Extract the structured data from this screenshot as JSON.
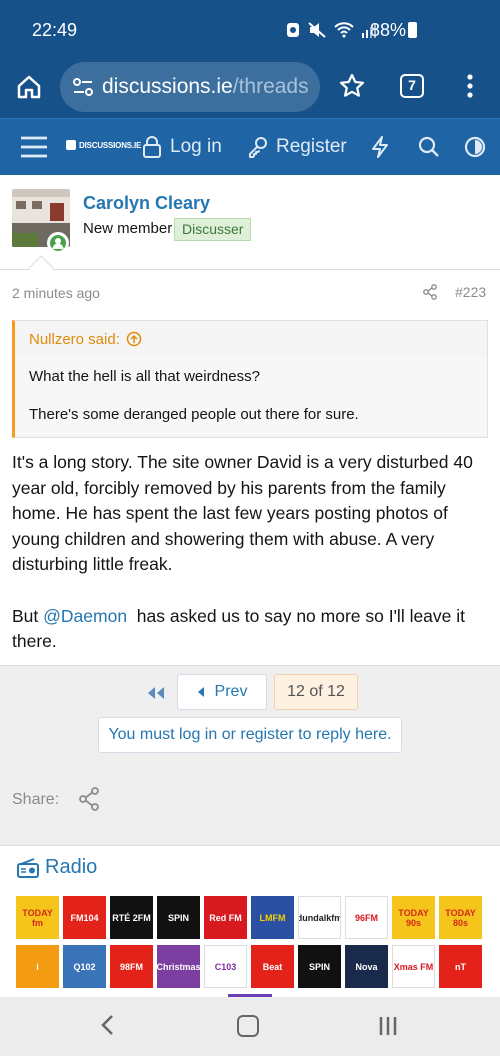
{
  "status_bar": {
    "time": "22:49",
    "battery": "88%"
  },
  "browser": {
    "url_host": "discussions.ie",
    "url_path": "/threads",
    "tab_count": "7"
  },
  "site_header": {
    "logo_text": "DISCUSSIONS.IE",
    "login": "Log in",
    "register": "Register"
  },
  "post": {
    "username": "Carolyn Cleary",
    "user_title": "New member",
    "user_banner": "Discusser",
    "date": "2 minutes ago",
    "number": "#223",
    "quote": {
      "author": "Nullzero said:",
      "line1": "What the hell is all that weirdness?",
      "line2": "There's some deranged people out there for sure."
    },
    "body_p1": "It's a long story. The site owner David is a very disturbed 40 year old, forcibly removed by his parents from the family home. He has spent the last few years posting photos of young children and showering them with abuse. A very disturbing little freak.",
    "body_p2_prefix": "But ",
    "body_p2_mention": "@Daemon",
    "body_p2_suffix": "  has asked us to say no more so I'll leave it there."
  },
  "pagination": {
    "prev": "Prev",
    "page": "12 of 12"
  },
  "reply_notice": "You must log in or register to reply here.",
  "share_label": "Share:",
  "radio": {
    "title": "Radio",
    "stations": [
      {
        "name": "TODAY fm",
        "bg": "#f6c51b",
        "fg": "#d22a1a"
      },
      {
        "name": "FM104",
        "bg": "#e32219",
        "fg": "#ffffff"
      },
      {
        "name": "RTÉ 2FM",
        "bg": "#111111",
        "fg": "#ffffff"
      },
      {
        "name": "SPIN",
        "bg": "#111111",
        "fg": "#ffffff"
      },
      {
        "name": "Red FM",
        "bg": "#d71920",
        "fg": "#ffffff"
      },
      {
        "name": "LMFM",
        "bg": "#2a4fa3",
        "fg": "#f5d100"
      },
      {
        "name": "dundalkfm",
        "bg": "#ffffff",
        "fg": "#222222"
      },
      {
        "name": "96FM",
        "bg": "#ffffff",
        "fg": "#d71920"
      },
      {
        "name": "TODAY 90s",
        "bg": "#f6c51b",
        "fg": "#d22a1a"
      },
      {
        "name": "TODAY 80s",
        "bg": "#f6c51b",
        "fg": "#d22a1a"
      },
      {
        "name": "i",
        "bg": "#f39c11",
        "fg": "#ffffff"
      },
      {
        "name": "Q102",
        "bg": "#3b73b9",
        "fg": "#ffffff"
      },
      {
        "name": "98FM",
        "bg": "#e32219",
        "fg": "#ffffff"
      },
      {
        "name": "Christmas",
        "bg": "#7a3fa0",
        "fg": "#ffffff"
      },
      {
        "name": "C103",
        "bg": "#ffffff",
        "fg": "#7b2fa1"
      },
      {
        "name": "Beat",
        "bg": "#e32219",
        "fg": "#ffffff"
      },
      {
        "name": "SPIN",
        "bg": "#111111",
        "fg": "#ffffff"
      },
      {
        "name": "Nova",
        "bg": "#1a2a4a",
        "fg": "#ffffff"
      },
      {
        "name": "Xmas FM",
        "bg": "#ffffff",
        "fg": "#d71920"
      },
      {
        "name": "nT",
        "bg": "#e32219",
        "fg": "#ffffff"
      }
    ]
  }
}
